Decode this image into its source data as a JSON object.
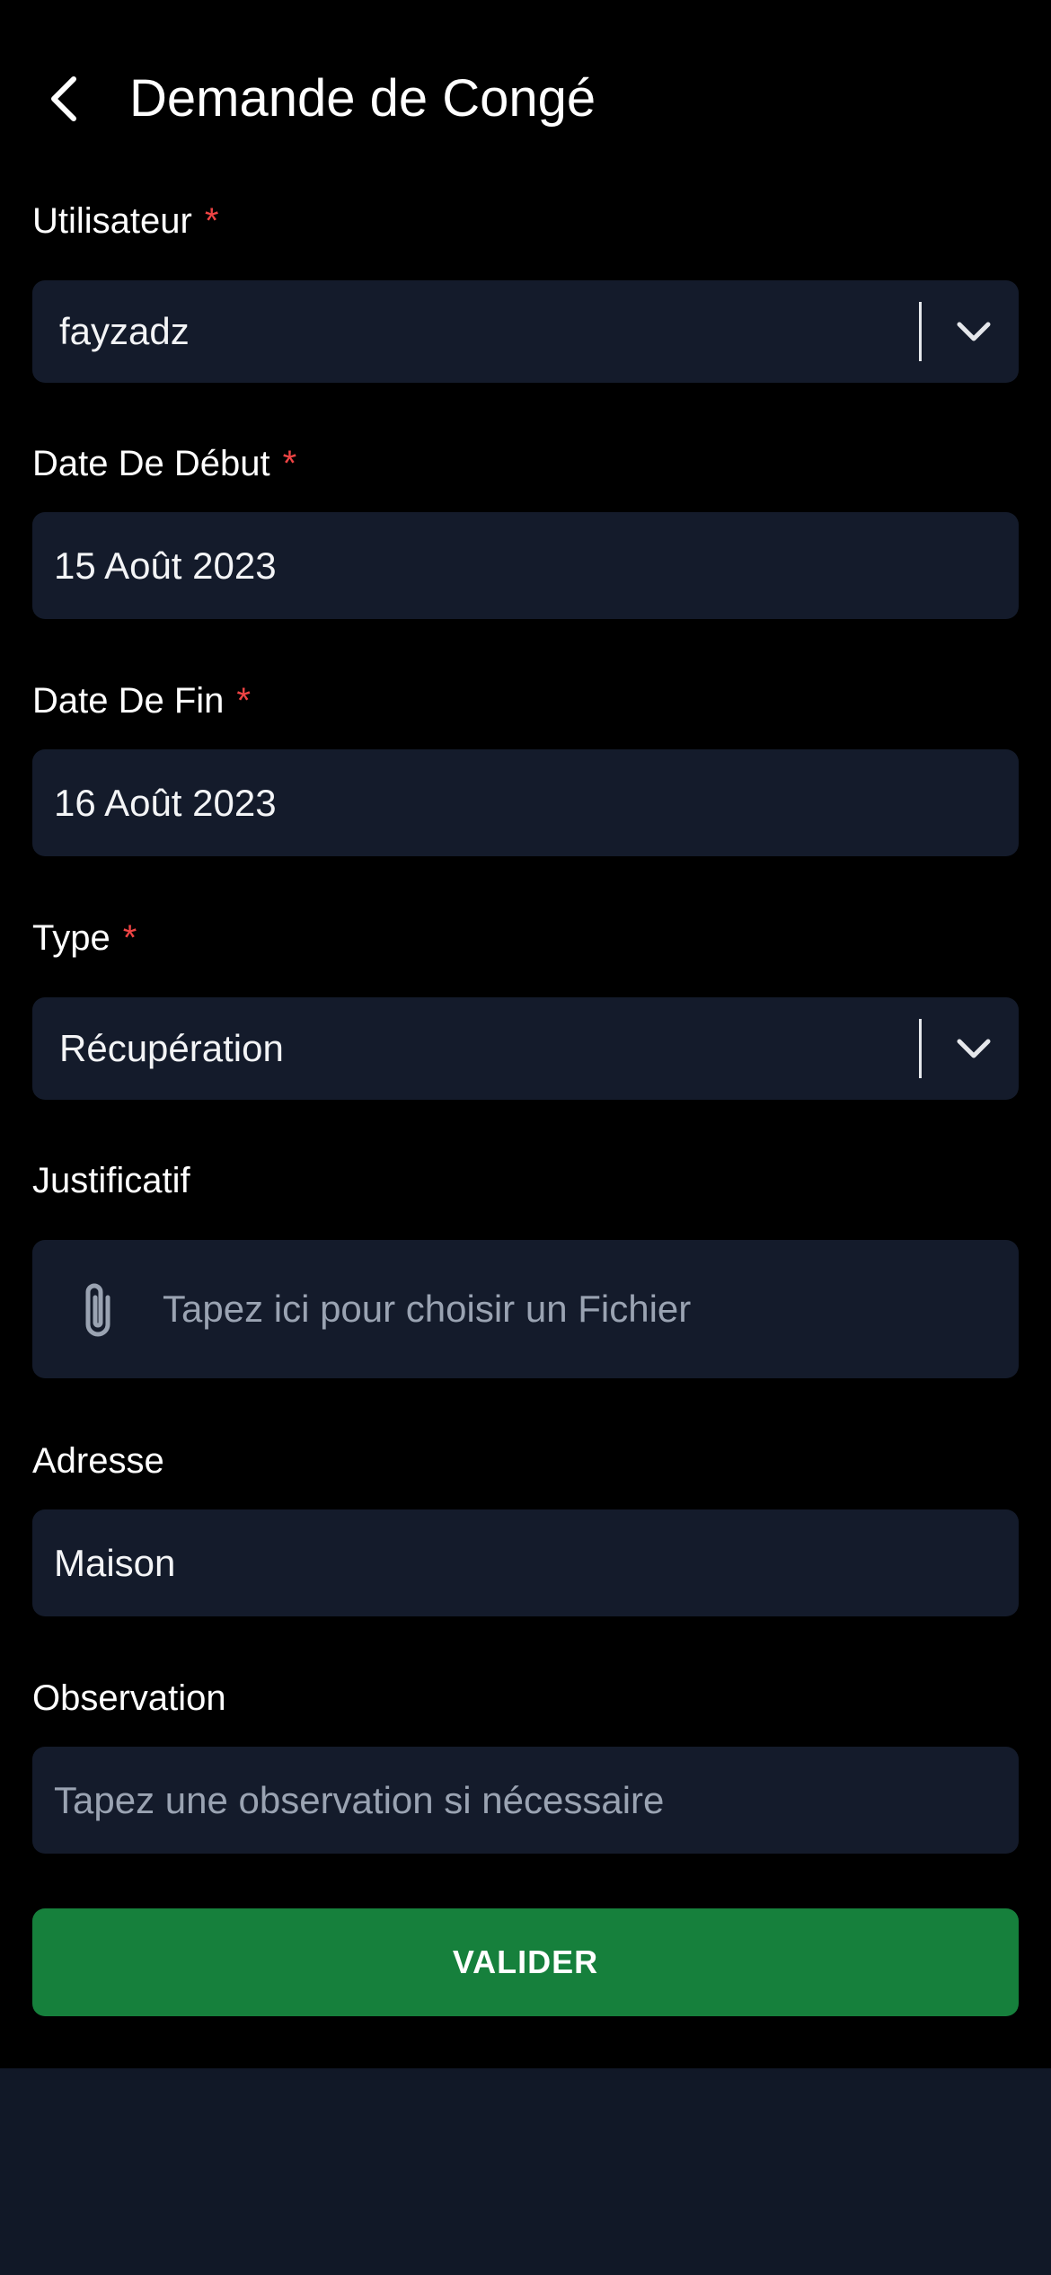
{
  "header": {
    "title": "Demande de Congé",
    "back_icon": "chevron-left-icon"
  },
  "required_marker": "*",
  "form": {
    "utilisateur": {
      "label": "Utilisateur",
      "value": "fayzadz",
      "required": true
    },
    "date_debut": {
      "label": "Date De Début",
      "value": "15 Août 2023",
      "required": true
    },
    "date_fin": {
      "label": "Date De Fin",
      "value": "16 Août 2023",
      "required": true
    },
    "type": {
      "label": "Type",
      "value": "Récupération",
      "required": true
    },
    "justificatif": {
      "label": "Justificatif",
      "placeholder": "Tapez ici pour choisir un Fichier",
      "icon": "paperclip-icon"
    },
    "adresse": {
      "label": "Adresse",
      "value": "Maison"
    },
    "observation": {
      "label": "Observation",
      "placeholder": "Tapez une observation si nécessaire"
    }
  },
  "submit_label": "VALIDER",
  "colors": {
    "background": "#000000",
    "field_bg": "#141b2b",
    "required": "#ef4444",
    "button": "#16803c",
    "footer": "#111827"
  }
}
